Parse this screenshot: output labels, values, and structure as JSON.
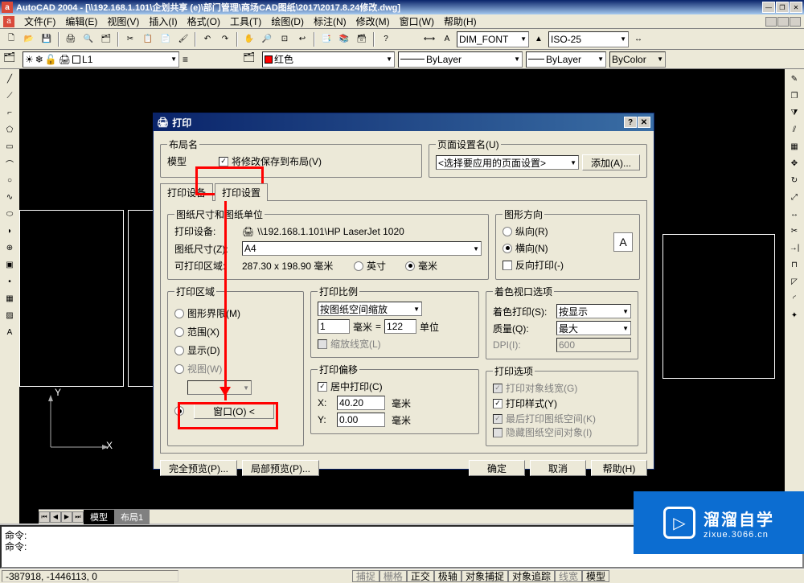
{
  "title": "AutoCAD 2004 - [\\\\192.168.1.101\\企划共享 (e)\\部门管理\\商场CAD图纸\\2017\\2017.8.24修改.dwg]",
  "menus": [
    "文件(F)",
    "编辑(E)",
    "视图(V)",
    "插入(I)",
    "格式(O)",
    "工具(T)",
    "绘图(D)",
    "标注(N)",
    "修改(M)",
    "窗口(W)",
    "帮助(H)"
  ],
  "dimstyle": "DIM_FONT",
  "iso": "ISO-25",
  "layer_combo": "L1",
  "color_combo": "红色",
  "linetype_combo": "ByLayer",
  "lweight_combo": "ByLayer",
  "plotstyle_combo": "ByColor",
  "model_tabs": {
    "active": "模型",
    "inactive": "布局1"
  },
  "cmd1": "命令:",
  "cmd2": "命令:",
  "coords": "-387918, -1446113, 0",
  "status_modes": [
    "捕捉",
    "栅格",
    "正交",
    "极轴",
    "对象捕捉",
    "对象追踪",
    "线宽",
    "模型"
  ],
  "dialog": {
    "title": "打印",
    "layout": {
      "legend": "布局名",
      "name": "模型",
      "save_to_layout": "将修改保存到布局(V)"
    },
    "page": {
      "legend": "页面设置名(U)",
      "value": "<选择要应用的页面设置>",
      "add": "添加(A)..."
    },
    "tabs": {
      "t1": "打印设备",
      "t2": "打印设置"
    },
    "paper": {
      "legend": "图纸尺寸和图纸单位",
      "device_lbl": "打印设备:",
      "device": "\\\\192.168.1.101\\HP LaserJet 1020",
      "size_lbl": "图纸尺寸(Z):",
      "size": "A4",
      "area_lbl": "可打印区域:",
      "area": "287.30 x 198.90 毫米",
      "inch": "英寸",
      "mm": "毫米"
    },
    "orientation": {
      "legend": "图形方向",
      "portrait": "纵向(R)",
      "landscape": "横向(N)",
      "reverse": "反向打印(-)",
      "icon": "A"
    },
    "plotarea": {
      "legend": "打印区域",
      "limits": "图形界限(M)",
      "extents": "范围(X)",
      "display": "显示(D)",
      "view": "视图(W)",
      "window": "窗口(O) <"
    },
    "plotscale": {
      "legend": "打印比例",
      "scale": "按图纸空间缩放",
      "one": "1",
      "mm": "毫米",
      "eq": "=",
      "val": "122",
      "unit": "单位",
      "scalelw": "缩放线宽(L)"
    },
    "offset": {
      "legend": "打印偏移",
      "center": "居中打印(C)",
      "x_lbl": "X:",
      "x": "40.20",
      "y_lbl": "Y:",
      "y": "0.00",
      "unit": "毫米"
    },
    "shaded": {
      "legend": "着色视口选项",
      "shade_lbl": "着色打印(S):",
      "shade": "按显示",
      "quality_lbl": "质量(Q):",
      "quality": "最大",
      "dpi_lbl": "DPI(I):",
      "dpi": "600"
    },
    "options": {
      "legend": "打印选项",
      "lw": "打印对象线宽(G)",
      "styles": "打印样式(Y)",
      "last": "最后打印图纸空间(K)",
      "hide": "隐藏图纸空间对象(I)"
    },
    "buttons": {
      "full": "完全预览(P)...",
      "partial": "局部预览(P)...",
      "ok": "确定",
      "cancel": "取消",
      "help": "帮助(H)"
    }
  },
  "ucs": {
    "y": "Y",
    "x": "X"
  },
  "watermark": {
    "big": "溜溜自学",
    "small": "zixue.3066.cn"
  }
}
